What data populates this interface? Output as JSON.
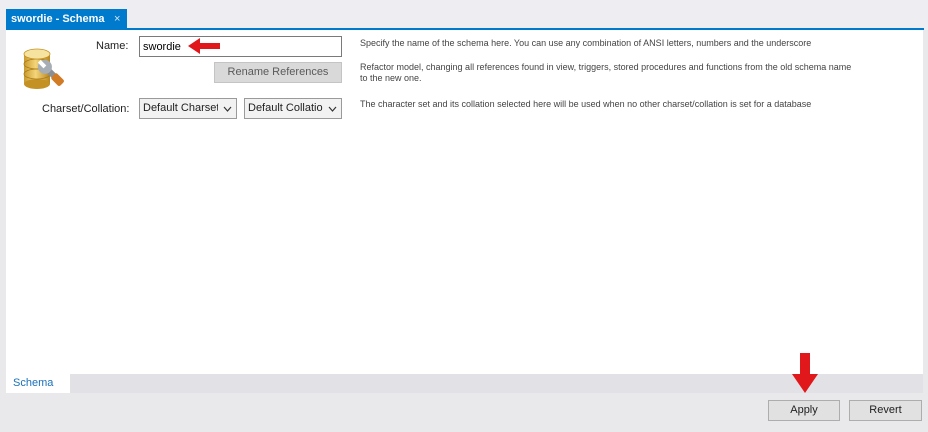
{
  "tab": {
    "title": "swordie - Schema",
    "close_glyph": "×"
  },
  "form": {
    "name_label": "Name:",
    "name_value": "swordie",
    "rename_button": "Rename References",
    "charset_label": "Charset/Collation:",
    "charset_value": "Default Charset",
    "collation_value": "Default Collation"
  },
  "descriptions": {
    "name": "Specify the name of the schema here. You can use any combination of ANSI letters, numbers and the underscore",
    "rename_line1": "Refactor model, changing all references found in view, triggers, stored procedures and functions from the old schema name",
    "rename_line2": "to the new one.",
    "charset": "The character set and its collation selected here will be used when no other charset/collation is set for a database"
  },
  "bottom_tabs": {
    "schema": "Schema"
  },
  "actions": {
    "apply": "Apply",
    "revert": "Revert"
  },
  "colors": {
    "accent": "#007acc",
    "annotation_arrow": "#e0181c"
  },
  "icons": {
    "schema": "database-wrench-icon",
    "close": "close-icon",
    "dropdown": "chevron-down-icon",
    "annotation": "red-arrow-icon"
  }
}
